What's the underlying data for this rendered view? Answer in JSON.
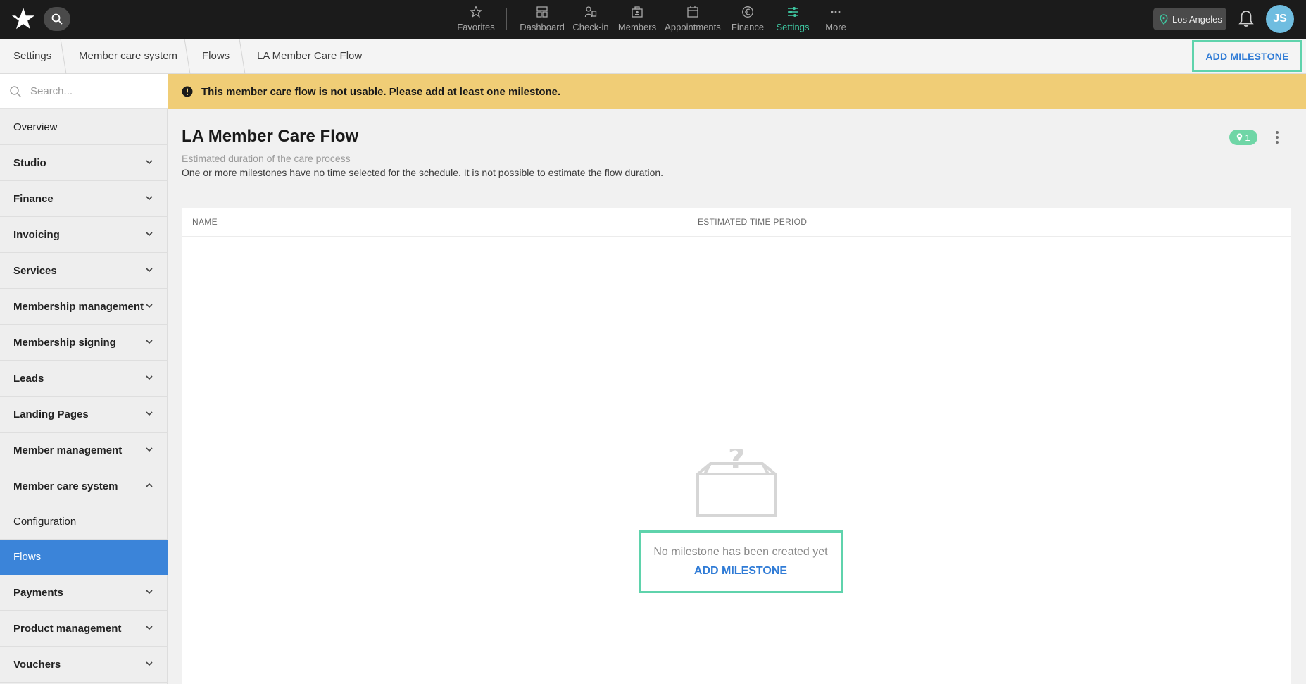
{
  "topbar": {
    "nav": [
      {
        "label": "Favorites",
        "icon": "star-icon"
      },
      {
        "label": "Dashboard",
        "icon": "dashboard-icon"
      },
      {
        "label": "Check-in",
        "icon": "check-in-icon"
      },
      {
        "label": "Members",
        "icon": "members-icon"
      },
      {
        "label": "Appointments",
        "icon": "calendar-icon"
      },
      {
        "label": "Finance",
        "icon": "euro-icon"
      },
      {
        "label": "Settings",
        "icon": "sliders-icon",
        "active": true
      },
      {
        "label": "More",
        "icon": "more-icon"
      }
    ],
    "location": "Los Angeles",
    "avatar_initials": "JS",
    "accent_color": "#3ec7a1"
  },
  "breadcrumb": {
    "items": [
      "Settings",
      "Member care system",
      "Flows",
      "LA Member Care Flow"
    ],
    "action_label": "ADD MILESTONE"
  },
  "sidebar": {
    "search_placeholder": "Search...",
    "items": [
      {
        "label": "Overview"
      },
      {
        "label": "Studio"
      },
      {
        "label": "Finance"
      },
      {
        "label": "Invoicing"
      },
      {
        "label": "Services"
      },
      {
        "label": "Membership management"
      },
      {
        "label": "Membership signing"
      },
      {
        "label": "Leads"
      },
      {
        "label": "Landing Pages"
      },
      {
        "label": "Member management"
      },
      {
        "label": "Member care system"
      },
      {
        "label": "Configuration"
      },
      {
        "label": "Flows"
      },
      {
        "label": "Payments"
      },
      {
        "label": "Product management"
      },
      {
        "label": "Vouchers"
      }
    ],
    "active_color": "#3b84d9"
  },
  "banner": {
    "text": "This member care flow is not usable. Please add at least one milestone.",
    "color": "#f0cd76"
  },
  "main": {
    "title": "LA Member Care Flow",
    "milestone_badge_count": "1",
    "subtitle": "Estimated duration of the care process",
    "description": "One or more milestones have no time selected for the schedule. It is not possible to estimate the flow duration.",
    "table": {
      "columns": [
        "NAME",
        "ESTIMATED TIME PERIOD"
      ]
    },
    "empty_state": {
      "text": "No milestone has been created yet",
      "action_label": "ADD MILESTONE"
    },
    "link_color": "#2f7bd6",
    "highlight_color": "#5fd3ac"
  }
}
